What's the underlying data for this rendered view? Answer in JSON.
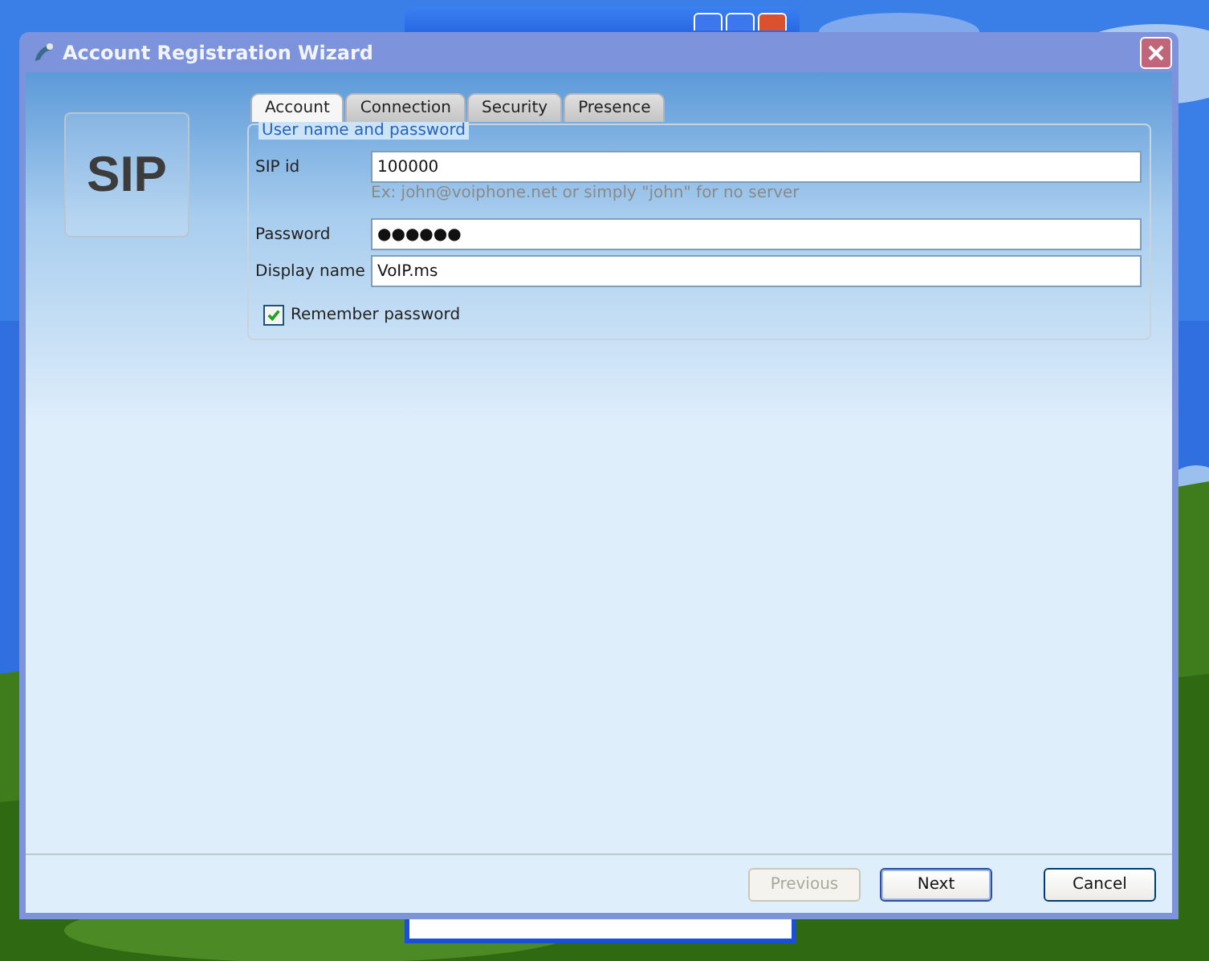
{
  "window": {
    "title": "Account Registration Wizard"
  },
  "logo": {
    "text": "SIP"
  },
  "tabs": [
    {
      "label": "Account",
      "selected": true
    },
    {
      "label": "Connection",
      "selected": false
    },
    {
      "label": "Security",
      "selected": false
    },
    {
      "label": "Presence",
      "selected": false
    }
  ],
  "group": {
    "title": "User name and password"
  },
  "fields": [
    {
      "label": "SIP id",
      "value": "100000",
      "hint": "Ex: john@voiphone.net or simply \"john\" for no server"
    },
    {
      "label": "Password",
      "value": "●●●●●●"
    },
    {
      "label": "Display name",
      "value": "VoIP.ms"
    }
  ],
  "remember": {
    "label": "Remember password",
    "checked": true
  },
  "buttons": [
    {
      "label": "Previous",
      "disabled": true,
      "default": false
    },
    {
      "label": "Next",
      "disabled": false,
      "default": true
    },
    {
      "label": "Cancel",
      "disabled": false,
      "default": false
    }
  ]
}
